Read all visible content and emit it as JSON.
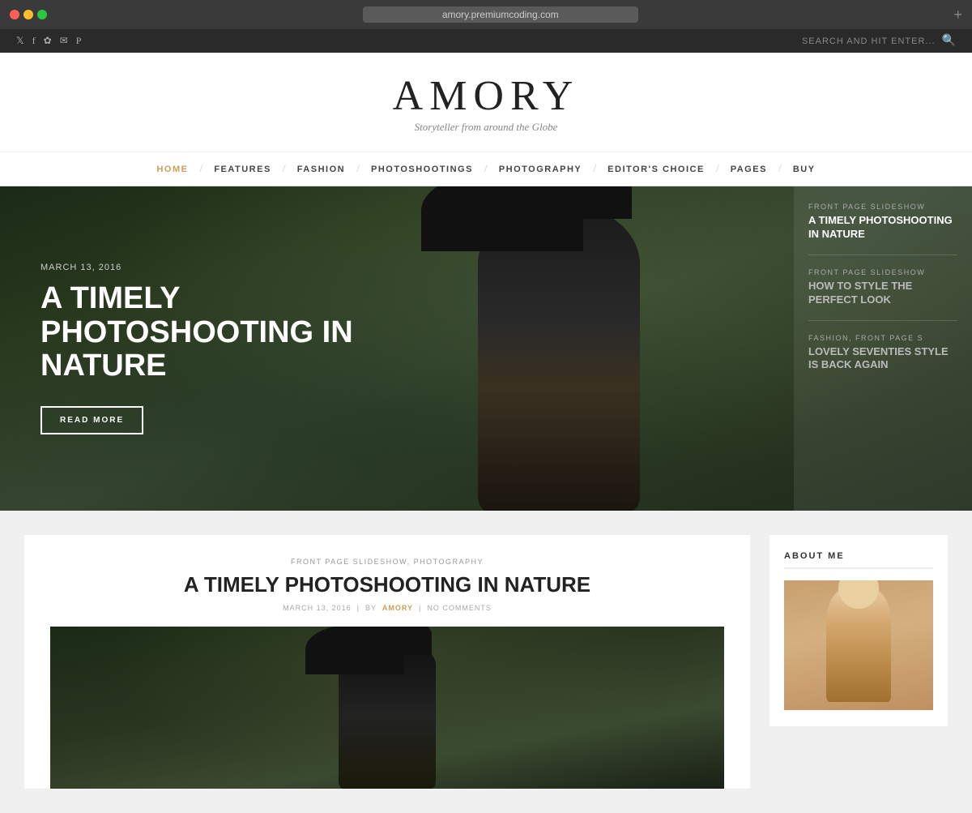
{
  "browser": {
    "url": "amory.premiumcoding.com",
    "new_tab_label": "+"
  },
  "topbar": {
    "social_icons": [
      "𝕏",
      "f",
      "✿",
      "✉",
      "P"
    ],
    "search_placeholder": "SEARCH AND HIT ENTER...",
    "search_icon": "🔍"
  },
  "header": {
    "site_title": "AMORY",
    "site_subtitle": "Storyteller from around the Globe"
  },
  "nav": {
    "items": [
      {
        "label": "HOME",
        "active": true
      },
      {
        "label": "FEATURES",
        "active": false
      },
      {
        "label": "FASHION",
        "active": false
      },
      {
        "label": "PHOTOSHOOTINGS",
        "active": false
      },
      {
        "label": "PHOTOGRAPHY",
        "active": false
      },
      {
        "label": "EDITOR'S CHOICE",
        "active": false
      },
      {
        "label": "PAGES",
        "active": false
      },
      {
        "label": "BUY",
        "active": false
      }
    ]
  },
  "hero": {
    "date": "MARCH 13, 2016",
    "title": "A TIMELY PHOTOSHOOTING IN NATURE",
    "read_more": "READ MORE",
    "sidebar": {
      "items": [
        {
          "category": "FRONT PAGE SLIDESHOW",
          "title": "A TIMELY PHOTOSHOOTING IN NATURE",
          "active": true
        },
        {
          "category": "FRONT PAGE SLIDESHOW",
          "title": "HOW TO STYLE THE PERFECT LOOK",
          "active": false
        },
        {
          "category": "FASHION, FRONT PAGE S",
          "title": "LOVELY SEVENTIES STYLE IS BACK AGAIN",
          "active": false
        }
      ]
    }
  },
  "article": {
    "category": "FRONT PAGE SLIDESHOW, PHOTOGRAPHY",
    "title": "A TIMELY PHOTOSHOOTING IN NATURE",
    "date": "MARCH 13, 2016",
    "by_label": "BY",
    "author": "AMORY",
    "comments": "NO COMMENTS"
  },
  "sidebar_widget": {
    "title": "ABOUT ME"
  }
}
